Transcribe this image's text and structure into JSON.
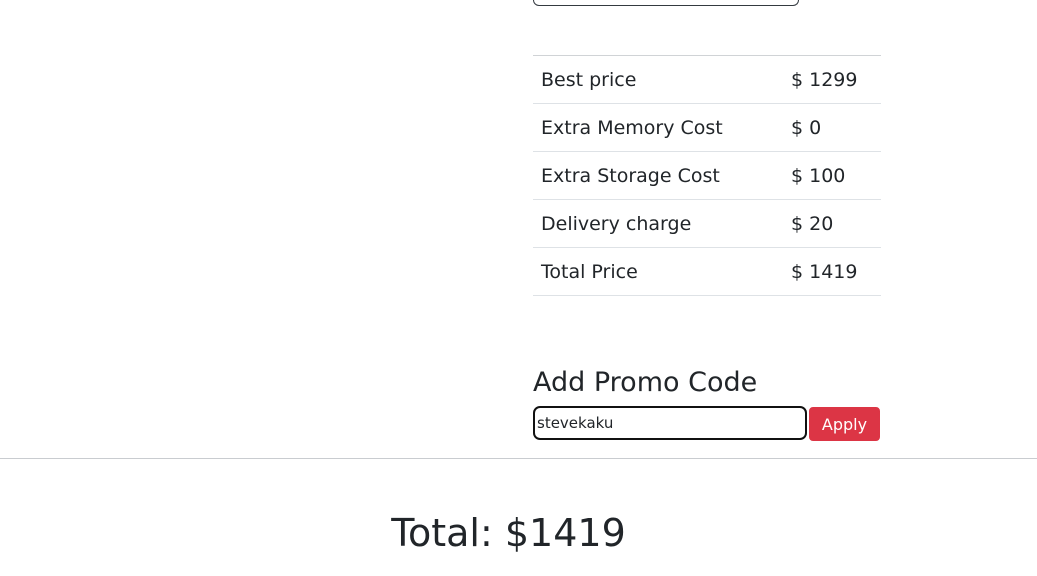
{
  "pricing": {
    "rows": [
      {
        "label": "Best price",
        "value": "$ 1299"
      },
      {
        "label": "Extra Memory Cost",
        "value": "$ 0"
      },
      {
        "label": "Extra Storage Cost",
        "value": "$ 100"
      },
      {
        "label": "Delivery charge",
        "value": "$ 20"
      }
    ],
    "total": {
      "label": "Total Price",
      "value": "$ 1419"
    }
  },
  "promo": {
    "title": "Add Promo Code",
    "input_value": "stevekaku",
    "apply_label": "Apply"
  },
  "footer": {
    "grand_total": "Total: $1419"
  },
  "colors": {
    "apply_button": "#dc3545",
    "text": "#212529"
  }
}
